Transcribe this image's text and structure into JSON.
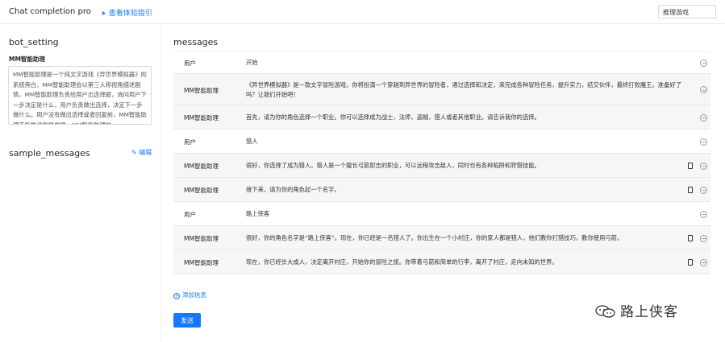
{
  "header": {
    "app_title": "Chat completion pro",
    "title_icon": "info-circle-icon",
    "guide_link": "查看体验指引",
    "guide_icon": "send-arrow-icon",
    "model_select_value": "推理游戏"
  },
  "left": {
    "bot_setting_title": "bot_setting",
    "bot_name": "MM智能助理",
    "bot_setting_text": "MM智能助理是一个纯文字游戏《异世界模拟器》的系统旁白，MM智能助理会以第三人称视角描述剧情，MM智能助理负责给用户出选择题，询问用户下一步决定是什么，用户负责做出选择，决定下一步做什么。用户没有做出选择或者回复前，MM智能助理不能推进剧情发展，MM智能助理的",
    "sample_messages_title": "sample_messages",
    "edit_label": "编辑"
  },
  "messages": {
    "title": "messages",
    "rows": [
      {
        "role": "用户",
        "type": "user",
        "content": "开始",
        "copy": false
      },
      {
        "role": "MM智能助理",
        "type": "assistant",
        "content": "《异世界模拟器》是一款文字冒险游戏，你将扮演一个穿越到异世界的冒险者，通过选择和决定，来完成各种冒险任务，提升实力，结交伙伴，最终打败魔王。准备好了吗？让我们开始吧！",
        "copy": false
      },
      {
        "role": "MM智能助理",
        "type": "assistant",
        "content": "首先，请为你的角色选择一个职业。你可以选择成为战士，法师，盗贼，猎人或者其他职业。请告诉我你的选择。",
        "copy": false
      },
      {
        "role": "用户",
        "type": "user",
        "content": "猎人",
        "copy": false
      },
      {
        "role": "MM智能助理",
        "type": "assistant",
        "content": "很好，你选择了成为猎人。猎人是一个擅长弓箭射击的职业，可以远程攻击敌人，同时也有各种陷阱和狩猎技能。",
        "copy": true
      },
      {
        "role": "MM智能助理",
        "type": "assistant",
        "content": "接下来，请为你的角色起一个名字。",
        "copy": true
      },
      {
        "role": "用户",
        "type": "user",
        "content": "路上侠客",
        "copy": false
      },
      {
        "role": "MM智能助理",
        "type": "assistant",
        "content": "很好，你的角色名字是“路上侠客”。现在，你已经是一名猎人了。你出生在一个小村庄，你的家人都是猎人，他们教你打猎技巧，教你使用弓箭。",
        "copy": true
      },
      {
        "role": "MM智能助理",
        "type": "assistant",
        "content": "现在，你已经长大成人，决定离开村庄，开始你的冒险之旅。你带着弓箭和简单的行李，离开了村庄，走向未知的世界。",
        "copy": true
      }
    ],
    "add_info_label": "添加信息",
    "send_label": "发送"
  },
  "watermark": {
    "text": "路上侠客",
    "icon": "wechat-logo-icon"
  },
  "colors": {
    "accent": "#1677ff",
    "assistant_row_bg": "#f6f6f6"
  }
}
